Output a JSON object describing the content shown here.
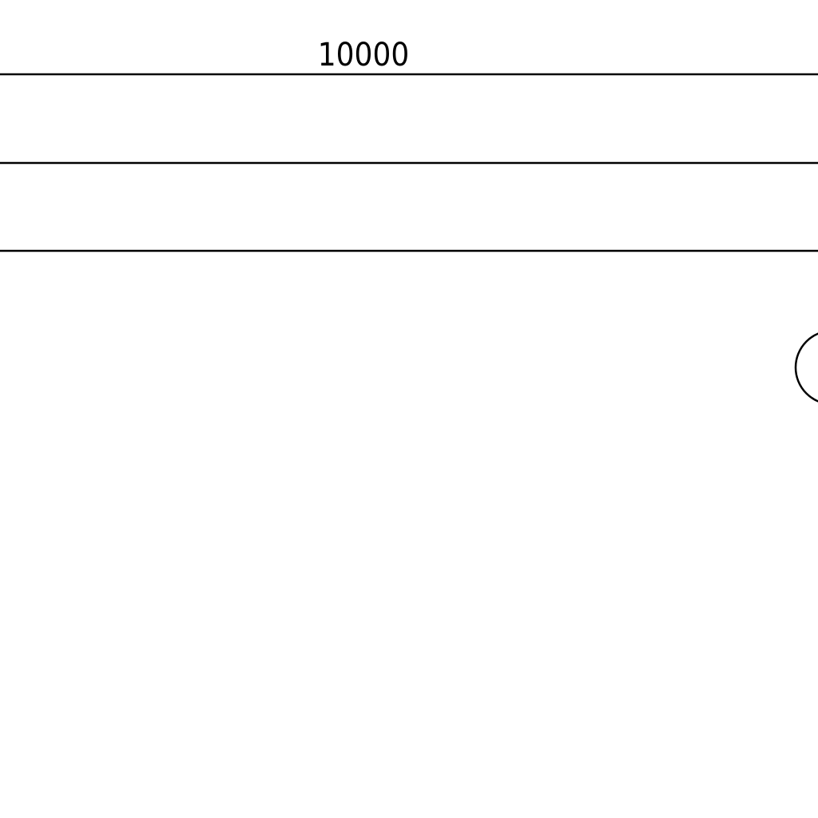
{
  "drawing": {
    "dimension_label": "10000",
    "line_color": "#000000",
    "background_color": "#ffffff"
  }
}
